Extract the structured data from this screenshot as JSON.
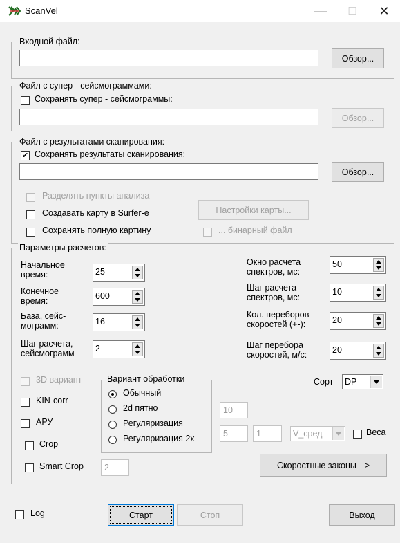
{
  "window": {
    "title": "ScanVel",
    "minimize": "—",
    "maximize": "☐",
    "close": "✕"
  },
  "input_group": {
    "label": "Входной файл:",
    "value": "",
    "browse": "Обзор..."
  },
  "super_group": {
    "label": "Файл с супер - сейсмограммами:",
    "save_label": "Сохранять супер - сейсмограммы:",
    "save_checked": false,
    "value": "",
    "browse": "Обзор..."
  },
  "results_group": {
    "label": "Файл с результатами сканирования:",
    "save_label": "Сохранять результаты сканирования:",
    "save_checked": true,
    "value": "",
    "browse": "Обзор...",
    "split_points": "Разделять пункты анализа",
    "surfer_map": "Создавать карту в Surfer-e",
    "map_settings": "Настройки карты...",
    "full_picture": "Сохранять полную картину",
    "binary": "... бинарный файл"
  },
  "params": {
    "label": "Параметры расчетов:",
    "start_time": {
      "label1": "Начальное",
      "label2": "время:",
      "value": "25"
    },
    "end_time": {
      "label1": "Конечное",
      "label2": "время:",
      "value": "600"
    },
    "base": {
      "label1": "База, сейс-",
      "label2": "могрaмм:",
      "value": "16"
    },
    "step": {
      "label1": "Шаг расчета,",
      "label2": "сейсмограмм",
      "value": "2"
    },
    "window": {
      "label1": "Окно расчета",
      "label2": "спектров, мс:",
      "value": "50"
    },
    "spec_step": {
      "label1": "Шаг расчета",
      "label2": "спектров, мс:",
      "value": "10"
    },
    "vel_count": {
      "label1": "Кол. переборов",
      "label2": "скоростей (+-):",
      "value": "20"
    },
    "vel_step": {
      "label1": "Шаг перебора",
      "label2": "скоростей, м/с:",
      "value": "20"
    },
    "variant_3d": "3D вариант",
    "kin_corr": "KIN-corr",
    "apu": "АРУ",
    "crop": "Crop",
    "smart_crop": "Smart Crop",
    "smart_crop_value": "2",
    "processing": {
      "label": "Вариант обработки",
      "options": [
        "Обычный",
        "2d пятно",
        "Регуляризация",
        "Регуляризация 2x"
      ],
      "selected": 0
    },
    "field_10": "10",
    "field_5": "5",
    "field_1": "1",
    "v_combo": "V_сред",
    "weights": "Веса",
    "sort_label": "Сорт",
    "sort_value": "DP",
    "velocity_laws": "Скоростные законы -->"
  },
  "bottom": {
    "log": "Log",
    "start": "Старт",
    "stop": "Стоп",
    "exit": "Выход"
  }
}
